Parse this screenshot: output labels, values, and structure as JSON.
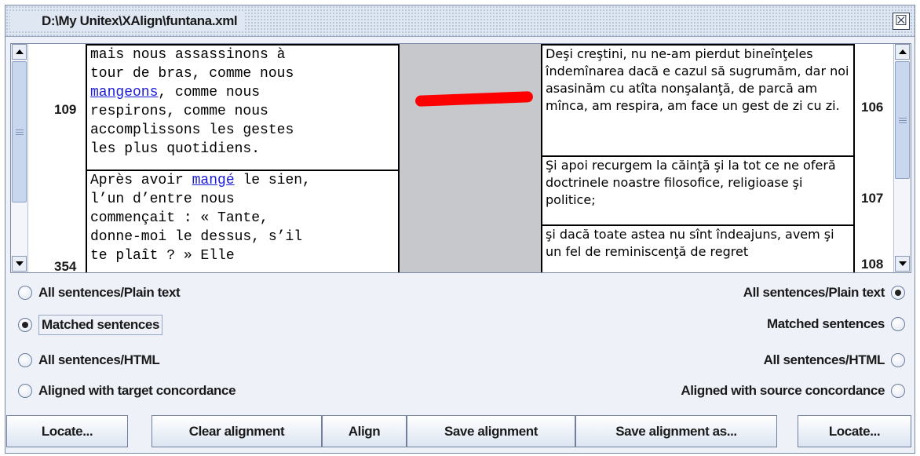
{
  "window": {
    "title": "D:\\My Unitex\\XAlign\\funtana.xml",
    "close_glyph": "☒"
  },
  "source": {
    "items": [
      {
        "number": "109",
        "text_pre": "mais nous assassinons à\ntour de bras, comme nous\n",
        "link": "mangeons",
        "text_post": ", comme nous\nrespirons, comme nous\naccomplissons les gestes\nles plus quotidiens."
      },
      {
        "number": "354",
        "text_pre": "Après avoir ",
        "link": "mangé",
        "text_post": " le sien,\nl’un d’entre nous\ncommençait : « Tante,\ndonne-moi le dessus, s’il\nte plaît ? » Elle"
      }
    ]
  },
  "target": {
    "items": [
      {
        "number": "106",
        "text": "Deşi creştini, nu ne-am pierdut bineînţeles îndemînarea dacă e cazul să sugrumăm, dar noi asasinăm cu atîta nonşalanţă, de parcă am mînca, am respira, am face un gest de zi cu zi."
      },
      {
        "number": "107",
        "text": "Şi apoi recurgem la căinţă şi la tot ce ne oferă doctrinele noastre filosofice, religioase şi politice;"
      },
      {
        "number": "108",
        "text": "şi dacă toate astea nu sînt îndeajuns, avem şi un fel de reminiscenţă de regret"
      }
    ]
  },
  "left_options": [
    {
      "label": "All sentences/Plain text",
      "checked": false
    },
    {
      "label": "Matched sentences",
      "checked": true
    },
    {
      "label": "All sentences/HTML",
      "checked": false
    },
    {
      "label": "Aligned with target concordance",
      "checked": false
    }
  ],
  "right_options": [
    {
      "label": "All sentences/Plain text",
      "checked": true
    },
    {
      "label": "Matched sentences",
      "checked": false
    },
    {
      "label": "All sentences/HTML",
      "checked": false
    },
    {
      "label": "Aligned with source concordance",
      "checked": false
    }
  ],
  "buttons": {
    "locate_left": "Locate...",
    "clear": "Clear alignment",
    "align": "Align",
    "save": "Save alignment",
    "save_as": "Save alignment as...",
    "locate_right": "Locate..."
  },
  "colors": {
    "alignment_link": "#ff0000",
    "link_text": "#1a1adb"
  }
}
